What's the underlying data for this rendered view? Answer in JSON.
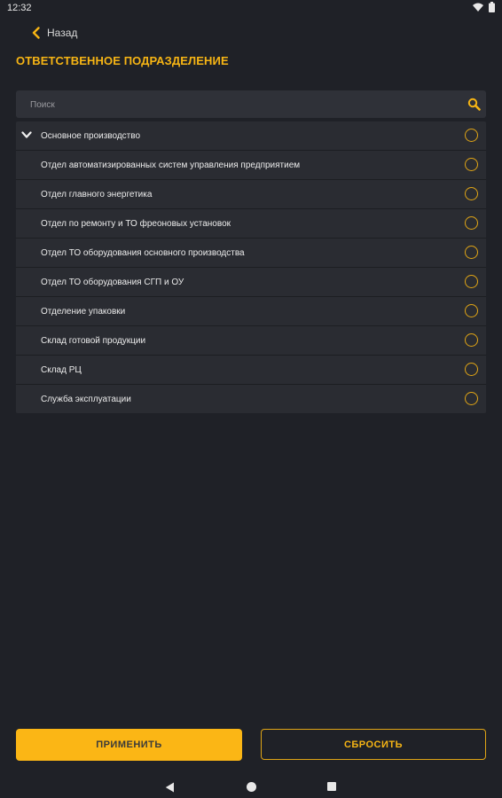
{
  "status_bar": {
    "time": "12:32"
  },
  "header": {
    "back_label": "Назад",
    "title": "ОТВЕТСТВЕННОЕ ПОДРАЗДЕЛЕНИЕ"
  },
  "search": {
    "placeholder": "Поиск",
    "value": ""
  },
  "list": {
    "group_label": "Основное производство",
    "items": [
      "Отдел автоматизированных систем управления предприятием",
      "Отдел главного энергетика",
      "Отдел по ремонту и ТО фреоновых установок",
      "Отдел ТО оборудования основного производства",
      "Отдел ТО оборудования СГП и ОУ",
      "Отделение упаковки",
      "Склад готовой продукции",
      "Склад РЦ",
      "Служба эксплуатации"
    ]
  },
  "buttons": {
    "apply": "ПРИМЕНИТЬ",
    "reset": "СБРОСИТЬ"
  },
  "colors": {
    "accent": "#fbb615",
    "background": "#1f2127",
    "row": "#2a2c32"
  }
}
